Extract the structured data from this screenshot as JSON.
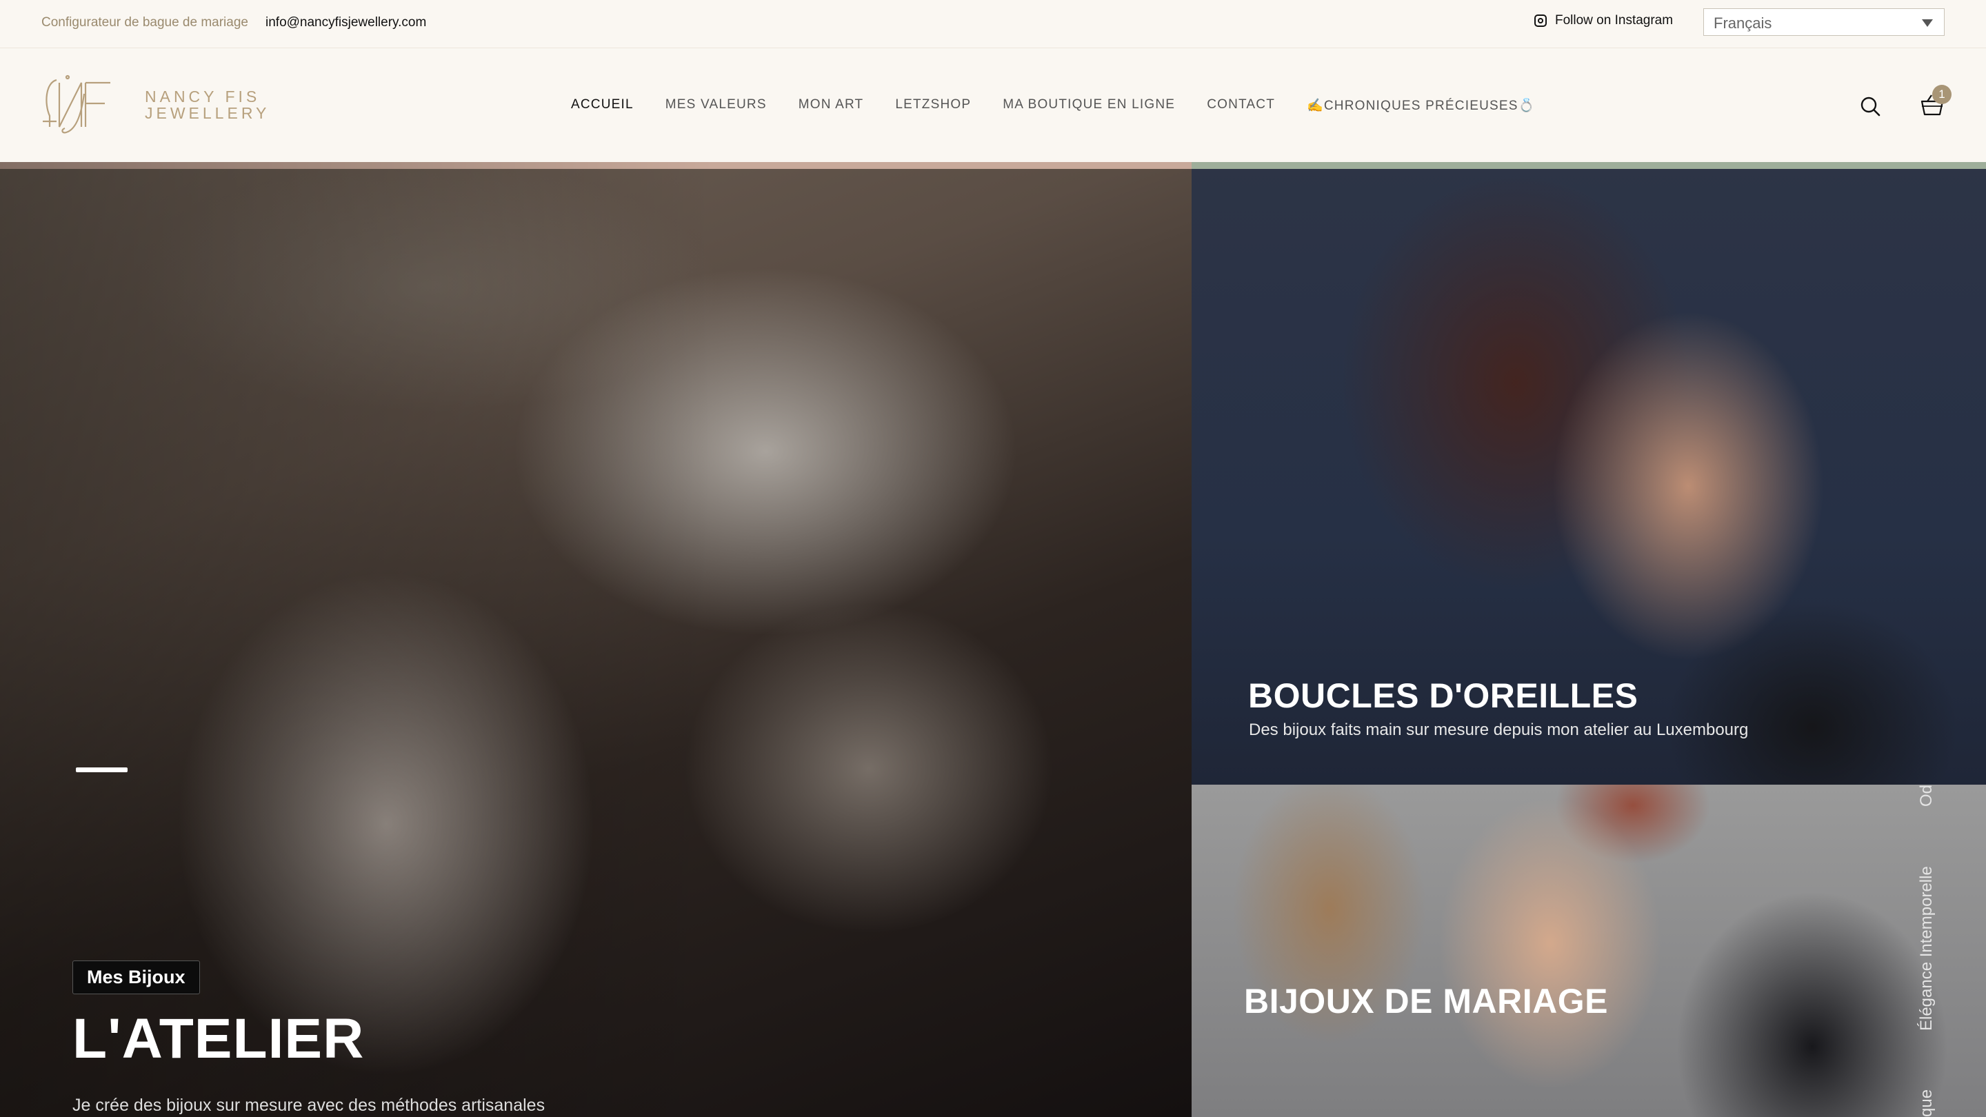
{
  "topbar": {
    "configurator_link": "Configurateur de bague de mariage",
    "email": "info@nancyfisjewellery.com",
    "instagram_label": "Follow on Instagram",
    "language_selected": "Français"
  },
  "header": {
    "logo_line1": "NANCY FIS",
    "logo_line2": "JEWELLERY",
    "nav": [
      {
        "label": "ACCUEIL",
        "active": true
      },
      {
        "label": "MES VALEURS"
      },
      {
        "label": "MON ART"
      },
      {
        "label": "LETZSHOP"
      },
      {
        "label": "MA BOUTIQUE EN LIGNE"
      },
      {
        "label": "CONTACT"
      },
      {
        "label": "✍️CHRONIQUES PRÉCIEUSES💍"
      }
    ],
    "cart_count": "1"
  },
  "hero": {
    "tag": "Mes Bijoux",
    "title": "L'ATELIER",
    "subtitle": "Je crée des bijoux sur mesure avec des méthodes artisanales"
  },
  "cards": {
    "earrings_title": "BOUCLES D'OREILLES",
    "earrings_sub": "Des bijoux faits main sur mesure depuis mon atelier au Luxembourg",
    "wedding_title": "BIJOUX DE MARIAGE",
    "vertical_1": "Od",
    "vertical_2": "Élégance Intemporelle",
    "vertical_3": "que"
  },
  "colors": {
    "accent_gold": "#b7a07d",
    "background": "#faf7f2",
    "hero_band_left": "#c8a99a",
    "hero_band_right": "#9eae9a"
  }
}
